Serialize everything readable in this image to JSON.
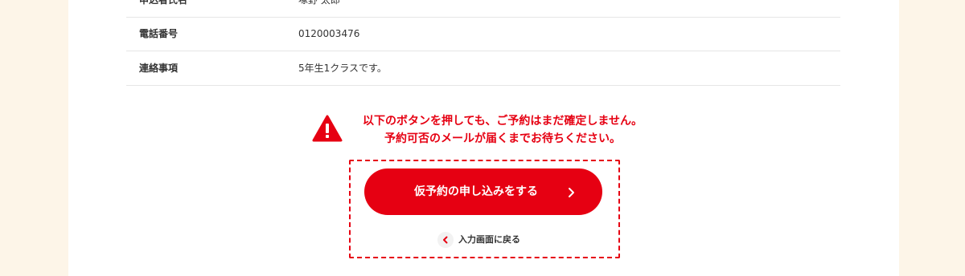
{
  "confirm_table": {
    "rows": [
      {
        "label": "申込者氏名",
        "value": "塚野 太郎"
      },
      {
        "label": "電話番号",
        "value": "0120003476"
      },
      {
        "label": "連絡事項",
        "value": "5年生1クラスです。"
      }
    ]
  },
  "warning": {
    "icon": "warning-triangle-icon",
    "line1": "以下のボタンを押しても、ご予約はまだ確定しません。",
    "line2": "予約可否のメールが届くまでお待ちください。"
  },
  "actions": {
    "submit_label": "仮予約の申し込みをする",
    "back_label": "入力画面に戻る"
  },
  "colors": {
    "accent": "#e60012",
    "page_bg": "#fdf5e8",
    "panel_bg": "#ffffff"
  }
}
